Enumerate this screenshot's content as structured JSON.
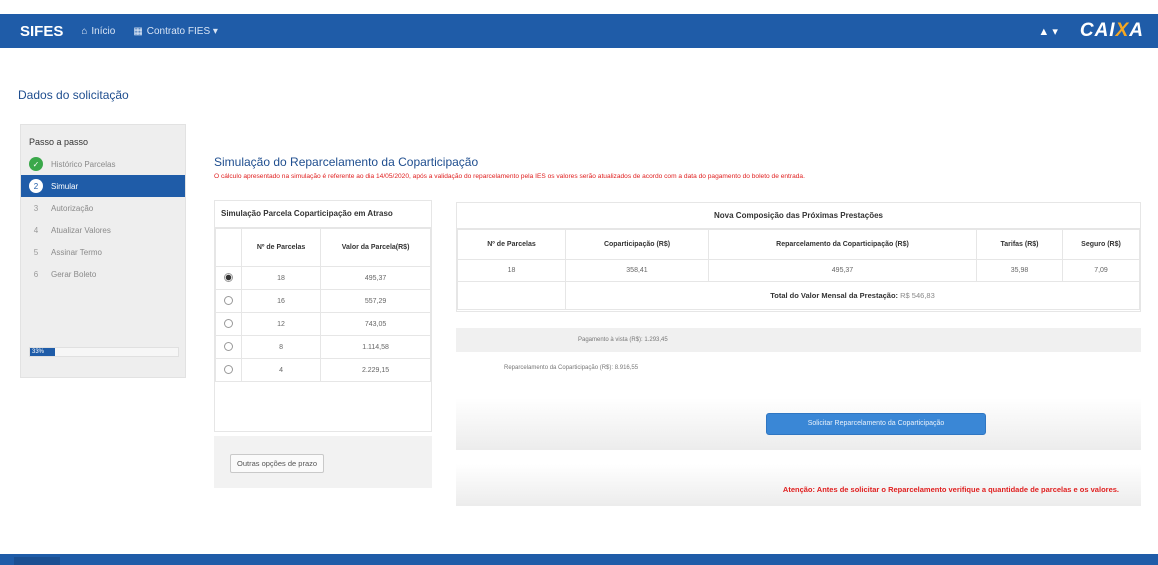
{
  "header": {
    "brand": "SIFES",
    "nav": [
      {
        "icon": "home-icon",
        "label": "Início"
      },
      {
        "icon": "grid-icon",
        "label": "Contrato FIES ▾"
      }
    ],
    "user_menu": "▲ ▾",
    "logo": "CAIXA"
  },
  "page_title": "Dados do solicitação",
  "sidebar": {
    "title": "Passo a passo",
    "steps": [
      {
        "bullet": "✓",
        "label": "Histórico Parcelas",
        "state": "done"
      },
      {
        "bullet": "2",
        "label": "Simular",
        "state": "active"
      },
      {
        "bullet": "3",
        "label": "Autorização",
        "state": "pending"
      },
      {
        "bullet": "4",
        "label": "Atualizar Valores",
        "state": "pending"
      },
      {
        "bullet": "5",
        "label": "Assinar Termo",
        "state": "pending"
      },
      {
        "bullet": "6",
        "label": "Gerar Boleto",
        "state": "pending"
      }
    ],
    "progress_label": "33%",
    "progress_value": 0.17
  },
  "main": {
    "title": "Simulação do Reparcelamento da Coparticipação",
    "warning": "O cálculo apresentado na simulação é referente ao dia 14/05/2020, após a validação do reparcelamento pela IES os valores serão atualizados de acordo com a data do pagamento do boleto de entrada."
  },
  "simulation": {
    "heading": "Simulação Parcela Coparticipação em Atraso",
    "col_parcelas": "Nº de Parcelas",
    "col_valor": "Valor da Parcela(R$)",
    "rows": [
      {
        "parcelas": "18",
        "valor": "495,37",
        "selected": true
      },
      {
        "parcelas": "16",
        "valor": "557,29",
        "selected": false
      },
      {
        "parcelas": "12",
        "valor": "743,05",
        "selected": false
      },
      {
        "parcelas": "8",
        "valor": "1.114,58",
        "selected": false
      },
      {
        "parcelas": "4",
        "valor": "2.229,15",
        "selected": false
      }
    ],
    "other_options_button": "Outras opções de prazo"
  },
  "composition": {
    "heading": "Nova Composição das Próximas Prestações",
    "columns": [
      "Nº de Parcelas",
      "Coparticipação (R$)",
      "Reparcelamento da Coparticipação (R$)",
      "Tarifas (R$)",
      "Seguro (R$)"
    ],
    "row": [
      "18",
      "358,41",
      "495,37",
      "35,98",
      "7,09"
    ],
    "total_label": "Total do Valor Mensal da Prestação:",
    "total_value": "R$ 546,83"
  },
  "summary": {
    "cash_payment": "Pagamento à vista (R$): 1.293,45",
    "reparcelamento": "Reparcelamento da Coparticipação (R$): 8.916,55"
  },
  "actions": {
    "submit": "Solicitar Reparcelamento da Coparticipação"
  },
  "alert": "Atenção: Antes de solicitar o Reparcelamento verifique a quantidade de parcelas e os valores."
}
